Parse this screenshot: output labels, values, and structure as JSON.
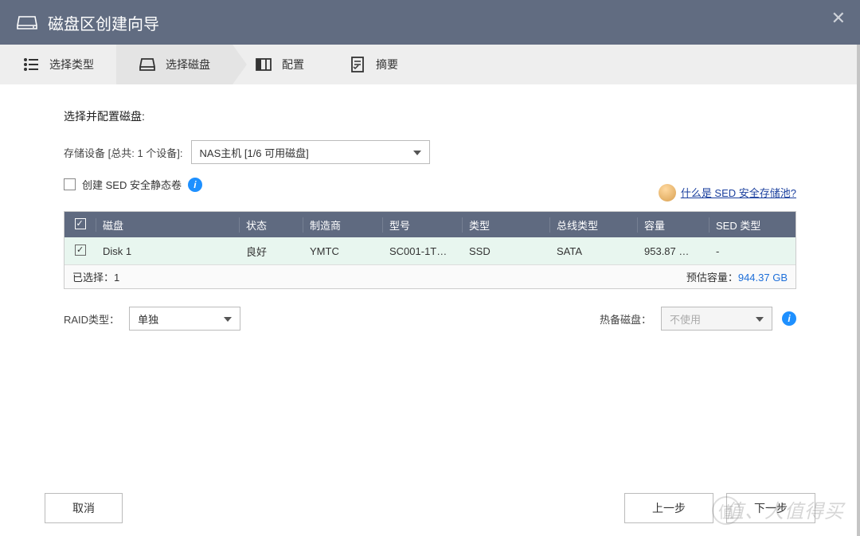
{
  "titlebar": {
    "title": "磁盘区创建向导"
  },
  "steps": {
    "s1": "选择类型",
    "s2": "选择磁盘",
    "s3": "配置",
    "s4": "摘要"
  },
  "content": {
    "heading": "选择并配置磁盘:",
    "storage_label": "存储设备 [总共: 1 个设备]:",
    "storage_value": "NAS主机 [1/6 可用磁盘]",
    "sed_checkbox_label": "创建 SED 安全静态卷",
    "sed_link": "什么是 SED 安全存储池?"
  },
  "table": {
    "headers": {
      "disk": "磁盘",
      "status": "状态",
      "mfr": "制造商",
      "model": "型号",
      "type": "类型",
      "bus": "总线类型",
      "cap": "容量",
      "sed": "SED 类型"
    },
    "row": {
      "disk": "Disk 1",
      "status": "良好",
      "mfr": "YMTC",
      "model": "SC001-1T…",
      "type": "SSD",
      "bus": "SATA",
      "cap": "953.87 …",
      "sed": "-"
    },
    "footer": {
      "selected": "已选择：1",
      "est_label": "预估容量：",
      "est_value": "944.37 GB"
    }
  },
  "raid": {
    "label": "RAID类型：",
    "value": "单独",
    "spare_label": "热备磁盘：",
    "spare_value": "不使用"
  },
  "buttons": {
    "cancel": "取消",
    "prev": "上一步",
    "next": "下一步"
  },
  "watermark": "值、大值得买"
}
